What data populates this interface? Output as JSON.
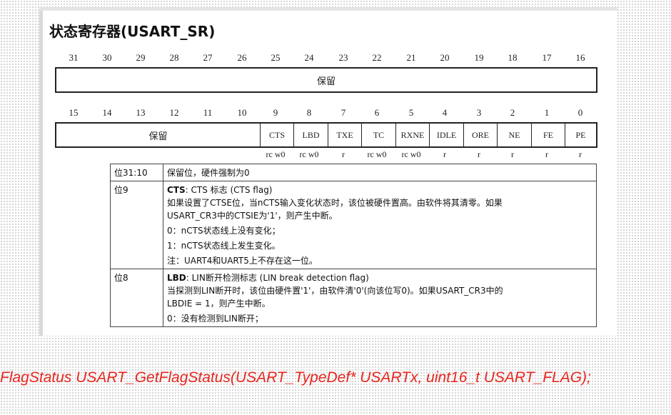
{
  "document": {
    "title": "状态寄存器(USART_SR)",
    "upper_bit_numbers": [
      "31",
      "30",
      "29",
      "28",
      "27",
      "26",
      "25",
      "24",
      "23",
      "22",
      "21",
      "20",
      "19",
      "18",
      "17",
      "16"
    ],
    "upper_reserved_label": "保留",
    "lower_bit_numbers": [
      "15",
      "14",
      "13",
      "12",
      "11",
      "10",
      "9",
      "8",
      "7",
      "6",
      "5",
      "4",
      "3",
      "2",
      "1",
      "0"
    ],
    "lower_reserved_label": "保留",
    "lower_fields": [
      "CTS",
      "LBD",
      "TXE",
      "TC",
      "RXNE",
      "IDLE",
      "ORE",
      "NE",
      "FE",
      "PE"
    ],
    "access": [
      "rc w0",
      "rc w0",
      "r",
      "rc w0",
      "rc w0",
      "r",
      "r",
      "r",
      "r",
      "r"
    ],
    "descriptions": [
      {
        "bit": "位31:10",
        "name": "",
        "lines": [
          "保留位，硬件强制为0"
        ]
      },
      {
        "bit": "位9",
        "name": "CTS",
        "heading_rest": ": CTS 标志 (CTS flag)",
        "lines": [
          "如果设置了CTSE位，当nCTS输入变化状态时，该位被硬件置高。由软件将其清零。如果",
          "USART_CR3中的CTSIE为'1'，则产生中断。",
          "0：nCTS状态线上没有变化；",
          "1：nCTS状态线上发生变化。",
          "注：UART4和UART5上不存在这一位。"
        ]
      },
      {
        "bit": "位8",
        "name": "LBD",
        "heading_rest": ": LIN断开检测标志 (LIN break detection flag)",
        "lines": [
          "当探测到LIN断开时，该位由硬件置'1'，由软件清'0'(向该位写0)。如果USART_CR3中的",
          "LBDIE = 1，则产生中断。",
          "0：没有检测到LIN断开；"
        ]
      }
    ]
  },
  "code_line": "FlagStatus USART_GetFlagStatus(USART_TypeDef* USARTx, uint16_t USART_FLAG);",
  "colors": {
    "code_text": "#e8271f",
    "table_border": "#222222",
    "doc_background": "#ffffff"
  }
}
